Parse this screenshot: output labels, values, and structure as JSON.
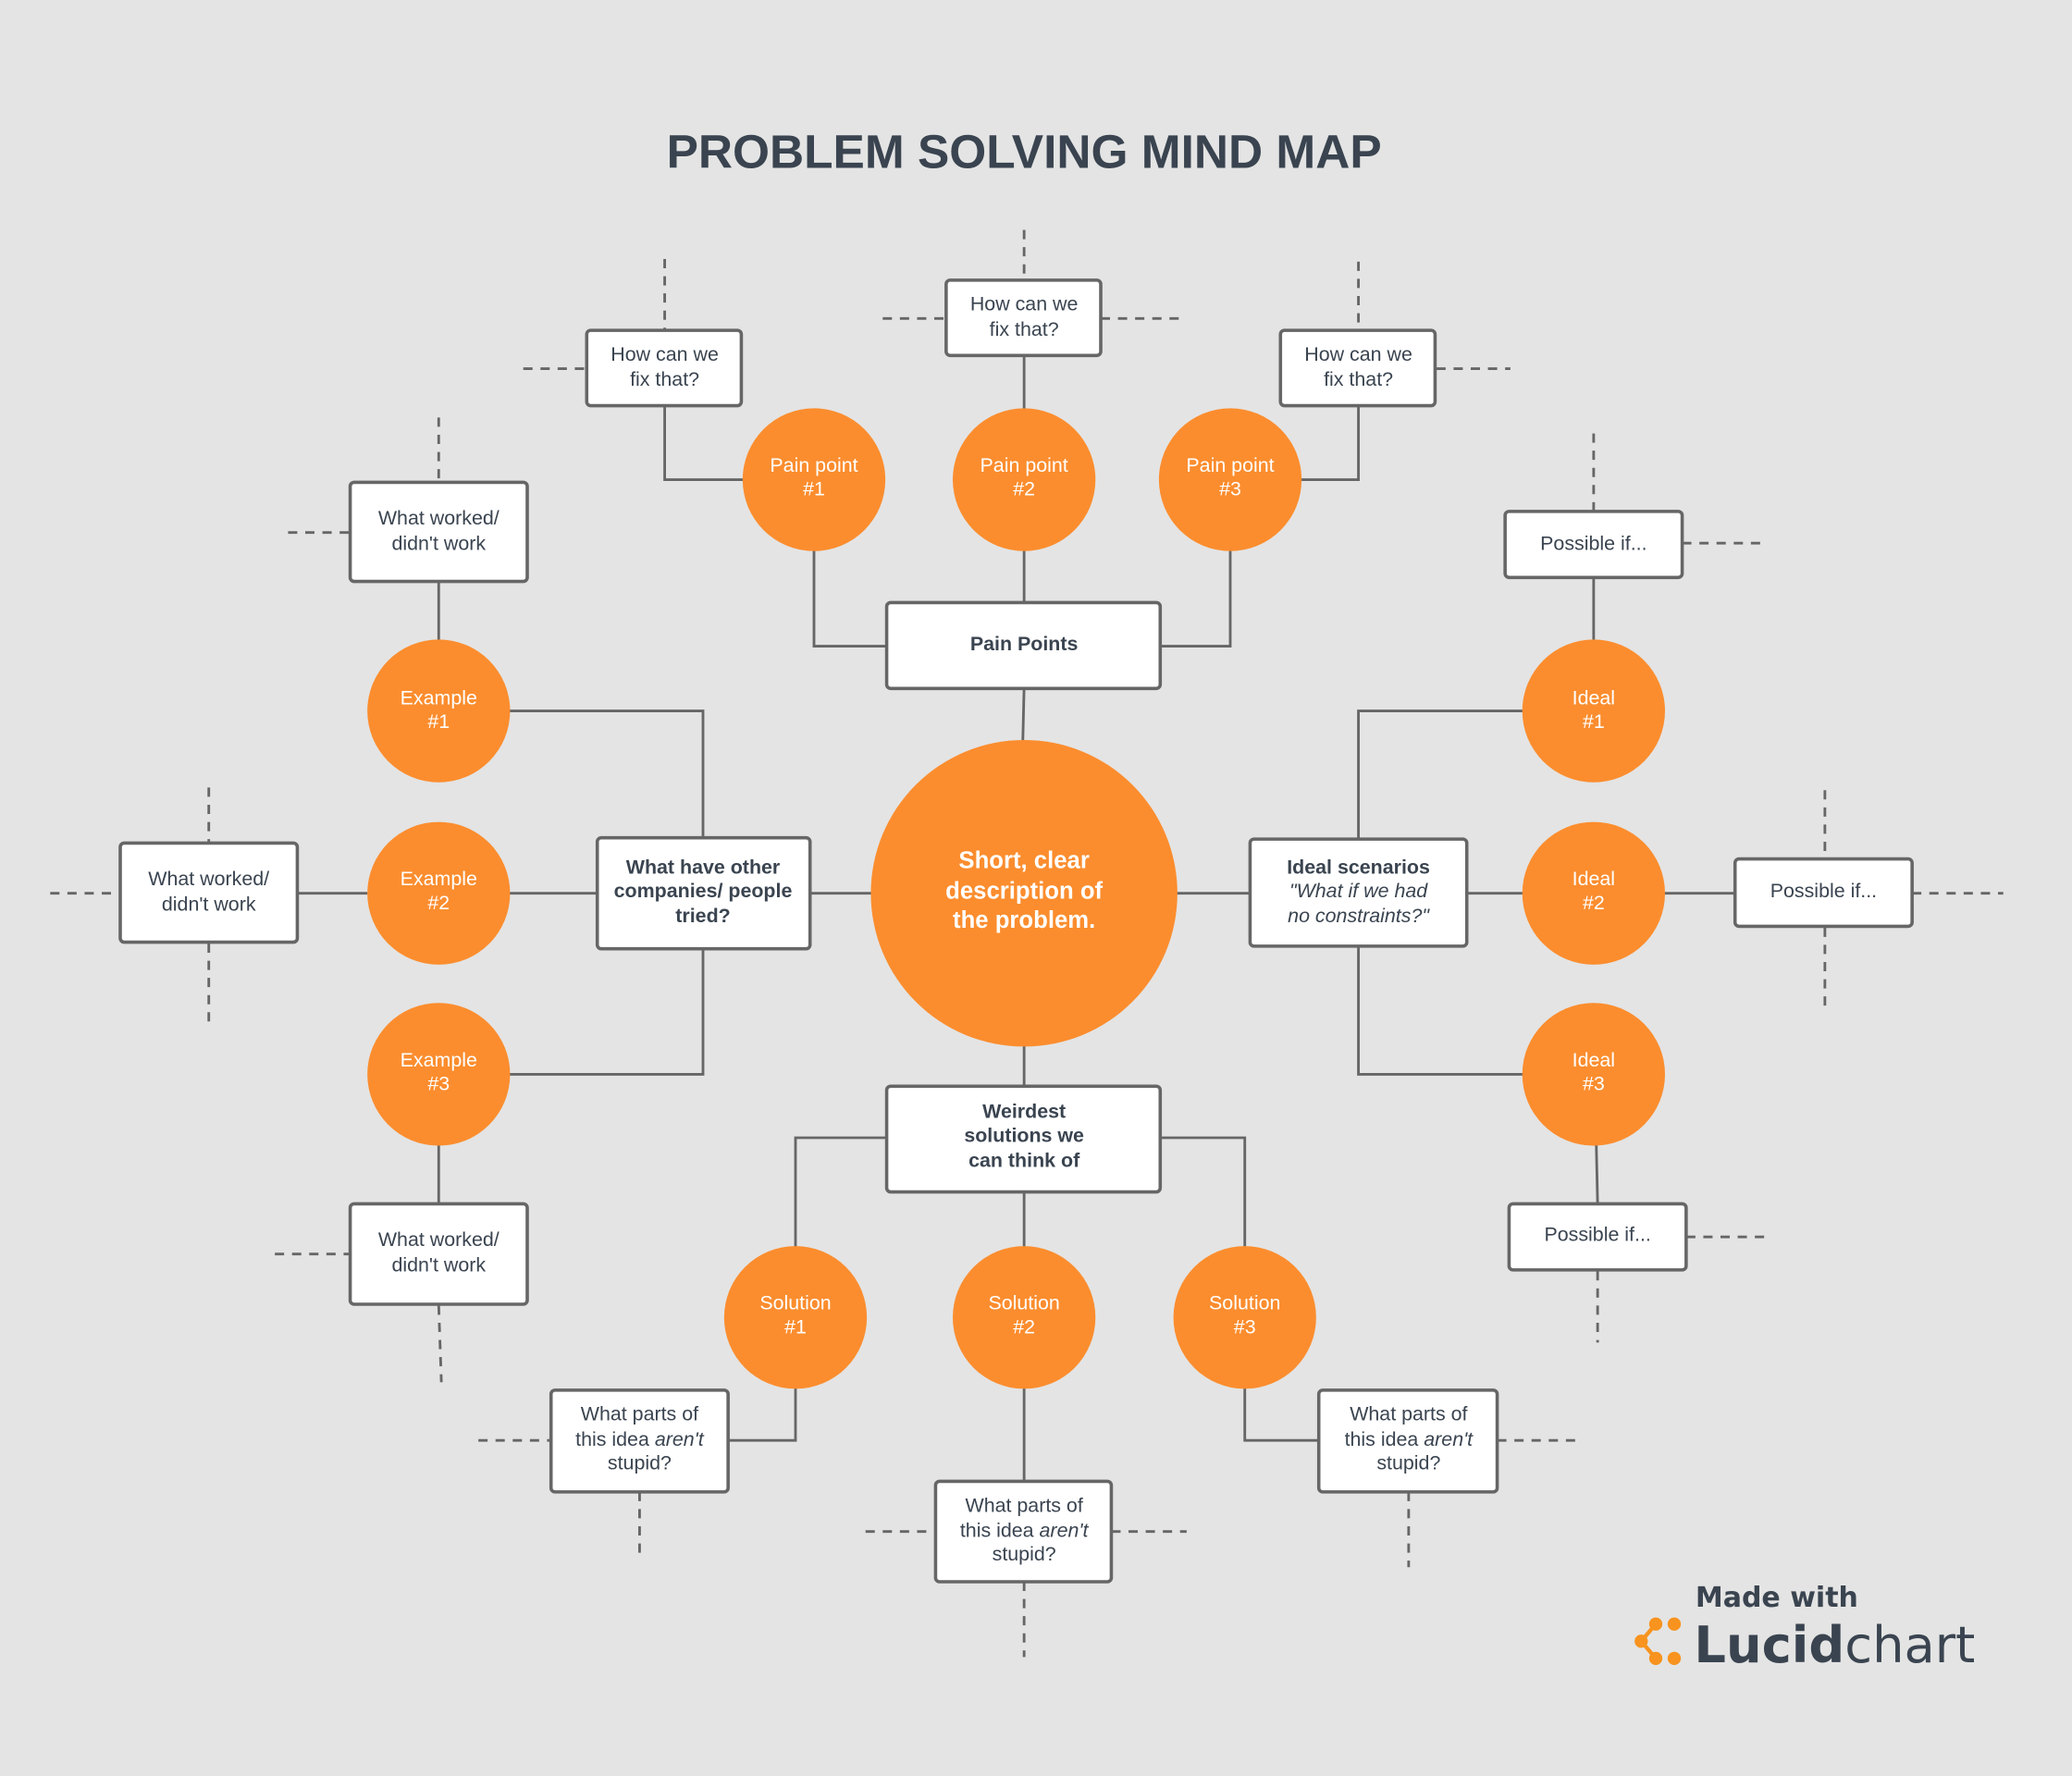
{
  "title": "PROBLEM SOLVING MIND MAP",
  "colors": {
    "background": "#e4e4e4",
    "node_orange": "#fb8d2e",
    "connector": "#666666",
    "text_dark": "#3a4450"
  },
  "center": {
    "lines": [
      "Short, clear",
      "description of",
      "the problem."
    ]
  },
  "branches": {
    "pain_points": {
      "label": "Pain Points",
      "children": [
        {
          "lines": [
            "Pain point",
            "#1"
          ],
          "leaf": [
            "How can we",
            "fix that?"
          ]
        },
        {
          "lines": [
            "Pain point",
            "#2"
          ],
          "leaf": [
            "How can we",
            "fix that?"
          ]
        },
        {
          "lines": [
            "Pain point",
            "#3"
          ],
          "leaf": [
            "How can we",
            "fix that?"
          ]
        }
      ]
    },
    "others_tried": {
      "lines": [
        "What have other",
        "companies/ people",
        "tried?"
      ],
      "children": [
        {
          "lines": [
            "Example",
            "#1"
          ],
          "leaf": [
            "What worked/",
            "didn't work"
          ]
        },
        {
          "lines": [
            "Example",
            "#2"
          ],
          "leaf": [
            "What worked/",
            "didn't work"
          ]
        },
        {
          "lines": [
            "Example",
            "#3"
          ],
          "leaf": [
            "What worked/",
            "didn't work"
          ]
        }
      ]
    },
    "ideal": {
      "heading": "Ideal scenarios",
      "sub_lines": [
        "\"What if we had",
        "no constraints?\""
      ],
      "children": [
        {
          "lines": [
            "Ideal",
            "#1"
          ],
          "leaf": "Possible if..."
        },
        {
          "lines": [
            "Ideal",
            "#2"
          ],
          "leaf": "Possible if..."
        },
        {
          "lines": [
            "Ideal",
            "#3"
          ],
          "leaf": "Possible if..."
        }
      ]
    },
    "weirdest": {
      "lines": [
        "Weirdest",
        "solutions we",
        "can think of"
      ],
      "children": [
        {
          "lines": [
            "Solution",
            "#1"
          ],
          "leaf": {
            "pre": "What parts of",
            "mid_plain": "this idea ",
            "mid_italic": "aren't",
            "post": "stupid?"
          }
        },
        {
          "lines": [
            "Solution",
            "#2"
          ],
          "leaf": {
            "pre": "What parts of",
            "mid_plain": "this idea ",
            "mid_italic": "aren't",
            "post": "stupid?"
          }
        },
        {
          "lines": [
            "Solution",
            "#3"
          ],
          "leaf": {
            "pre": "What parts of",
            "mid_plain": "this idea ",
            "mid_italic": "aren't",
            "post": "stupid?"
          }
        }
      ]
    }
  },
  "branding": {
    "made_with": "Made with",
    "brand_bold": "Lucid",
    "brand_light": "chart"
  }
}
